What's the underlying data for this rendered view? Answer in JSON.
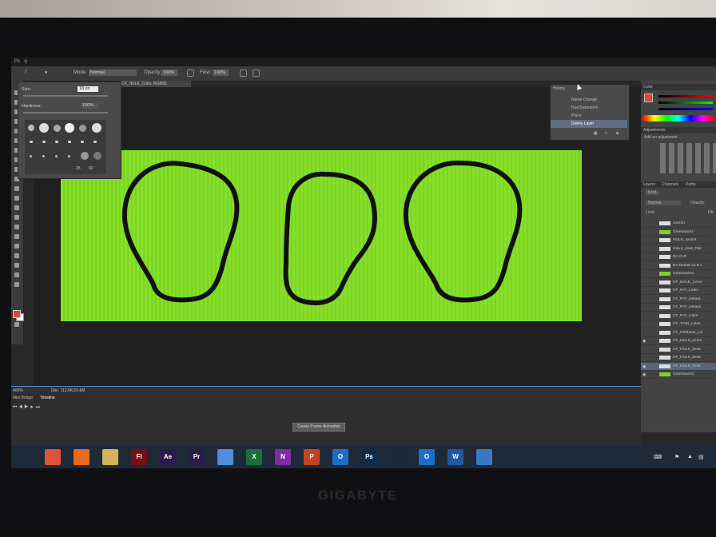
{
  "document_tab": "CF_HULK_Color, RGB/8)",
  "options_bar": {
    "mode_label": "Mode:",
    "mode_value": "Normal",
    "opacity_label": "Opacity:",
    "opacity_value": "100%",
    "flow_label": "Flow:",
    "flow_value": "100%"
  },
  "brush_panel": {
    "size_label": "Size:",
    "size_value": "18 px",
    "hardness_label": "Hardness:",
    "hardness_value": "100%",
    "tip_sizes": [
      "25",
      "50"
    ]
  },
  "history_panel": {
    "title": "History",
    "items": [
      "Name Change",
      "Hue/Saturation",
      "Place",
      "Delete Layer"
    ],
    "selected_index": 3
  },
  "right_panel": {
    "color_tab": "Color",
    "adjustments_tab": "Adjustments",
    "adjustments_hint": "Add an adjustment",
    "layers_tabs": [
      "Layers",
      "Channels",
      "Paths"
    ],
    "filter_kind": "Kind",
    "blend_mode": "Normal",
    "opacity_label": "Opacity:",
    "lock_label": "Lock:",
    "fill_label": "Fill:",
    "layers": [
      {
        "name": "Clinton",
        "visible": false,
        "thumb": "#dddddd"
      },
      {
        "name": "Greenback1",
        "visible": false,
        "thumb": "#7cd424"
      },
      {
        "name": "HULK_Jacket",
        "visible": false,
        "thumb": "#dddddd"
      },
      {
        "name": "HULK_Vest_Plat",
        "visible": false,
        "thumb": "#dddddd"
      },
      {
        "name": "BA CLR",
        "visible": false,
        "thumb": "#dddddd"
      },
      {
        "name": "BA Details CLR c",
        "visible": false,
        "thumb": "#dddddd"
      },
      {
        "name": "Greenback2",
        "visible": false,
        "thumb": "#7cd424"
      },
      {
        "name": "CF_MALE_Lines",
        "visible": false,
        "thumb": "#dddddd"
      },
      {
        "name": "CF_FAT_Lines",
        "visible": false,
        "thumb": "#dddddd"
      },
      {
        "name": "CF_FAT_Detail1",
        "visible": false,
        "thumb": "#dddddd"
      },
      {
        "name": "CF_FAT_Detail2",
        "visible": false,
        "thumb": "#dddddd"
      },
      {
        "name": "CF_FAT_Color",
        "visible": false,
        "thumb": "#dddddd"
      },
      {
        "name": "CF_THIN_Lines",
        "visible": false,
        "thumb": "#dddddd"
      },
      {
        "name": "CF_FEMALE_Lin",
        "visible": false,
        "thumb": "#dddddd"
      },
      {
        "name": "CF_HULK_Lines",
        "visible": true,
        "thumb": "#dddddd"
      },
      {
        "name": "CF_HULK_Deta",
        "visible": false,
        "thumb": "#dddddd"
      },
      {
        "name": "CF_HULK_Deta",
        "visible": false,
        "thumb": "#dddddd"
      },
      {
        "name": "CF_HULK_Colo",
        "visible": true,
        "thumb": "#dddddd"
      },
      {
        "name": "Greenback3",
        "visible": true,
        "thumb": "#7cd424"
      }
    ],
    "selected_layer_index": 17
  },
  "status_bar": {
    "zoom": "400%",
    "doc_size": "Doc: 112.6K/10.6M"
  },
  "timeline": {
    "tabs": [
      "Mini Bridge",
      "Timeline"
    ],
    "create_button": "Create Frame Animation"
  },
  "taskbar": {
    "apps": [
      {
        "name": "windows-start",
        "label": "",
        "color": "#1f2a38"
      },
      {
        "name": "power",
        "label": "",
        "color": "#e0533a"
      },
      {
        "name": "firefox",
        "label": "",
        "color": "#e66a1f"
      },
      {
        "name": "file-explorer",
        "label": "",
        "color": "#d6b35a"
      },
      {
        "name": "flash",
        "label": "Fl",
        "color": "#7a0f12"
      },
      {
        "name": "after-effects",
        "label": "Ae",
        "color": "#2a1b4d"
      },
      {
        "name": "premiere",
        "label": "Pr",
        "color": "#2a1b4d"
      },
      {
        "name": "chrome",
        "label": "",
        "color": "#4f8ed8"
      },
      {
        "name": "excel",
        "label": "X",
        "color": "#1e6e3a"
      },
      {
        "name": "onenote",
        "label": "N",
        "color": "#7b2f9e"
      },
      {
        "name": "powerpoint",
        "label": "P",
        "color": "#c9421f"
      },
      {
        "name": "outlook",
        "label": "O",
        "color": "#1c6fc4"
      },
      {
        "name": "photoshop",
        "label": "Ps",
        "color": "#0b2b4d"
      },
      {
        "name": "steam",
        "label": "",
        "color": "#1b2838"
      },
      {
        "name": "outlook-2",
        "label": "O",
        "color": "#1c6fc4"
      },
      {
        "name": "word",
        "label": "W",
        "color": "#2357a5"
      },
      {
        "name": "remote-desktop",
        "label": "",
        "color": "#3a78c2"
      }
    ]
  },
  "bezel_brand": "GIGABYTE",
  "colors": {
    "canvas_green": "#7cd424",
    "outline": "#111111",
    "accent_blue": "#4c8bd6",
    "foreground_swatch": "#e0453a"
  }
}
